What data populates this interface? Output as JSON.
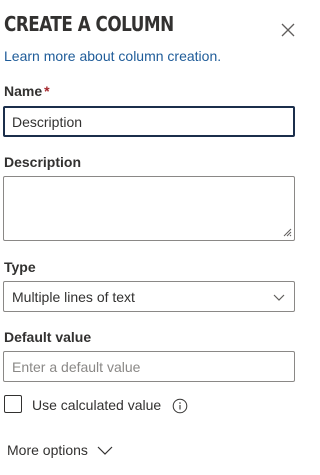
{
  "panel": {
    "title": "CREATE A COLUMN",
    "learn_more_link": "Learn more about column creation."
  },
  "name": {
    "label": "Name",
    "required_marker": "*",
    "value": "Description"
  },
  "description": {
    "label": "Description",
    "value": ""
  },
  "type": {
    "label": "Type",
    "selected": "Multiple lines of text"
  },
  "default_value": {
    "label": "Default value",
    "placeholder": "Enter a default value"
  },
  "calculated": {
    "label": "Use calculated value",
    "checked": false
  },
  "more_options": {
    "label": "More options"
  },
  "icons": {
    "close": "close-icon",
    "info": "info-icon",
    "chevron": "chevron-down-icon"
  },
  "colors": {
    "link": "#1f5c99",
    "required": "#a4262c",
    "focus_border": "#1b2e4b"
  }
}
